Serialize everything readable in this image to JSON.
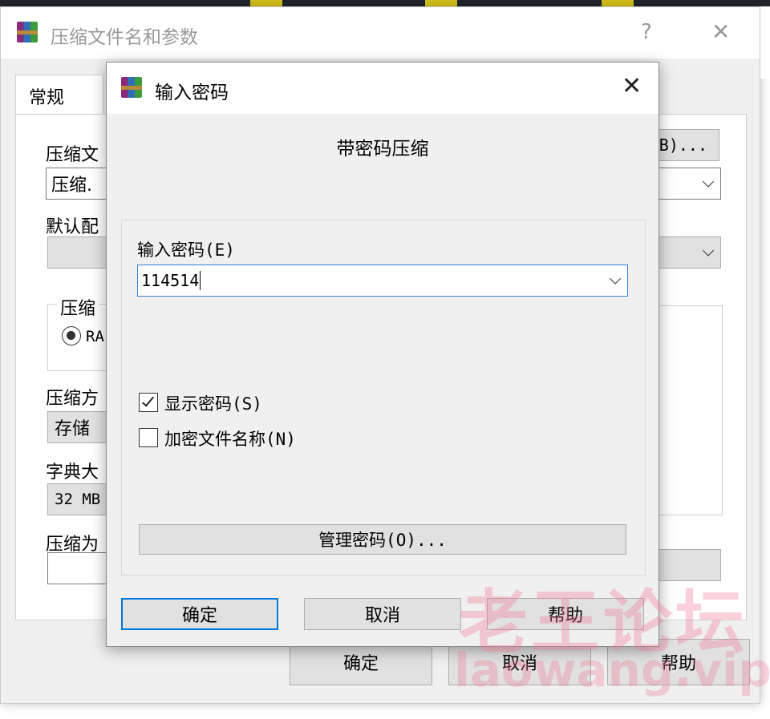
{
  "back_dialog": {
    "title": "压缩文件名和参数",
    "help_glyph": "?",
    "close_glyph": "✕",
    "tab_general": "常规",
    "archive_name_label": "压缩文",
    "archive_name_value": "压缩.",
    "browse_button": "B)...",
    "profile_label": "默认配",
    "format_group": "压缩",
    "format_radio": "RA",
    "method_label": "压缩方",
    "method_value": "存储",
    "dict_label": "字典大",
    "dict_value": "32 MB",
    "split_label": "压缩为",
    "ok": "确定",
    "cancel": "取消",
    "help": "帮助"
  },
  "dialog": {
    "title": "输入密码",
    "close_glyph": "✕",
    "heading": "带密码压缩",
    "password_label": "输入密码(E)",
    "password_value": "114514",
    "show_password_label": "显示密码(S)",
    "show_password_checked": true,
    "encrypt_names_label": "加密文件名称(N)",
    "encrypt_names_checked": false,
    "manage_button": "管理密码(O)...",
    "ok": "确定",
    "cancel": "取消",
    "help": "帮助"
  },
  "watermark": {
    "text_cn": "老王论坛",
    "text_url": "laowang.vip"
  }
}
